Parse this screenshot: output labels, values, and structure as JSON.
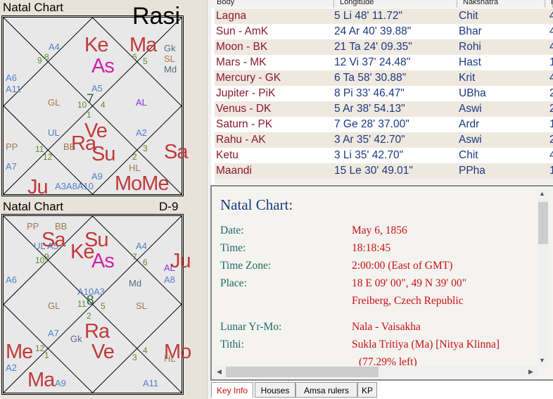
{
  "rasi": {
    "title": "Natal Chart",
    "label": "Rasi",
    "items": [
      "Ke",
      "Ma",
      "As",
      "Gk",
      "SL",
      "Md",
      "A4",
      "8",
      "9",
      "6",
      "5",
      "A6",
      "A11",
      "A5",
      "7",
      "10",
      "4",
      "1",
      "GL",
      "AL",
      "UL",
      "Ve",
      "Ra",
      "Su",
      "BB",
      "A2",
      "PP",
      "11",
      "12",
      "3",
      "2",
      "Sa",
      "HL",
      "A7",
      "A9",
      "Ju",
      "A3A8A10",
      "MoMe"
    ]
  },
  "navamsa": {
    "title": "Natal Chart",
    "label": "D-9",
    "items": [
      "PP",
      "BB",
      "UL A5",
      "Sa",
      "9",
      "10",
      "Ke",
      "Su",
      "As",
      "A4",
      "7",
      "6",
      "Ju",
      "AL",
      "A8",
      "A6",
      "Md",
      "A10A3",
      "8",
      "11",
      "5",
      "GL",
      "SL",
      "2",
      "A7",
      "Gk",
      "Ra",
      "Me",
      "12",
      "1",
      "Ve",
      "4",
      "3",
      "Mo",
      "HL",
      "A2",
      "Ma",
      "A9",
      "A11"
    ]
  },
  "table": {
    "headers": [
      "Body",
      "Longitude",
      "Nakshatra",
      "P"
    ],
    "rows": [
      [
        "Lagna",
        "5 Li 48' 11.72\"",
        "Chit",
        "4"
      ],
      [
        "Sun - AmK",
        "24 Ar 40' 39.88\"",
        "Bhar",
        "4"
      ],
      [
        "Moon - BK",
        "21 Ta 24' 09.35\"",
        "Rohi",
        "4"
      ],
      [
        "Mars - MK",
        "12 Vi 37' 24.48\"",
        "Hast",
        "1"
      ],
      [
        "Mercury - GK",
        "6 Ta 58' 30.88\"",
        "Krit",
        "4"
      ],
      [
        "Jupiter - PiK",
        "8 Pi 33' 46.47\"",
        "UBha",
        "2"
      ],
      [
        "Venus - DK",
        "5 Ar 38' 54.13\"",
        "Aswi",
        "2"
      ],
      [
        "Saturn - PK",
        "7 Ge 28' 37.00\"",
        "Ardr",
        "1"
      ],
      [
        "Rahu - AK",
        "3 Ar 35' 42.70\"",
        "Aswi",
        "2"
      ],
      [
        "Ketu",
        "3 Li 35' 42.70\"",
        "Chit",
        "4"
      ],
      [
        "Maandi",
        "15 Le 30' 49.01\"",
        "PPha",
        "1"
      ]
    ]
  },
  "info": {
    "title": "Natal Chart:",
    "rows": [
      [
        "Date:",
        "May 6, 1856"
      ],
      [
        "Time:",
        "18:18:45"
      ],
      [
        "Time Zone:",
        "2:00:00 (East of GMT)"
      ],
      [
        "Place:",
        "18 E 09' 00\", 49 N 39' 00\""
      ],
      [
        "",
        "Freiberg, Czech Republic"
      ],
      [
        "Lunar Yr-Mo:",
        "Nala - Vaisakha"
      ],
      [
        "Tithi:",
        "Sukla Tritiya (Ma) [Nitya Klinna]"
      ],
      [
        "",
        "(77.29% left)"
      ]
    ]
  },
  "tabs": [
    "Key Info",
    "Houses",
    "Amsa rulers",
    "KP"
  ],
  "active_tab": "Key Info",
  "colors": {
    "planet": "#c0393a",
    "ascendant": "#d020a8",
    "arudha": "#5080c8",
    "house_number": "#5a8a30",
    "label_red": "#c81010",
    "label_teal": "#1a6a60"
  }
}
